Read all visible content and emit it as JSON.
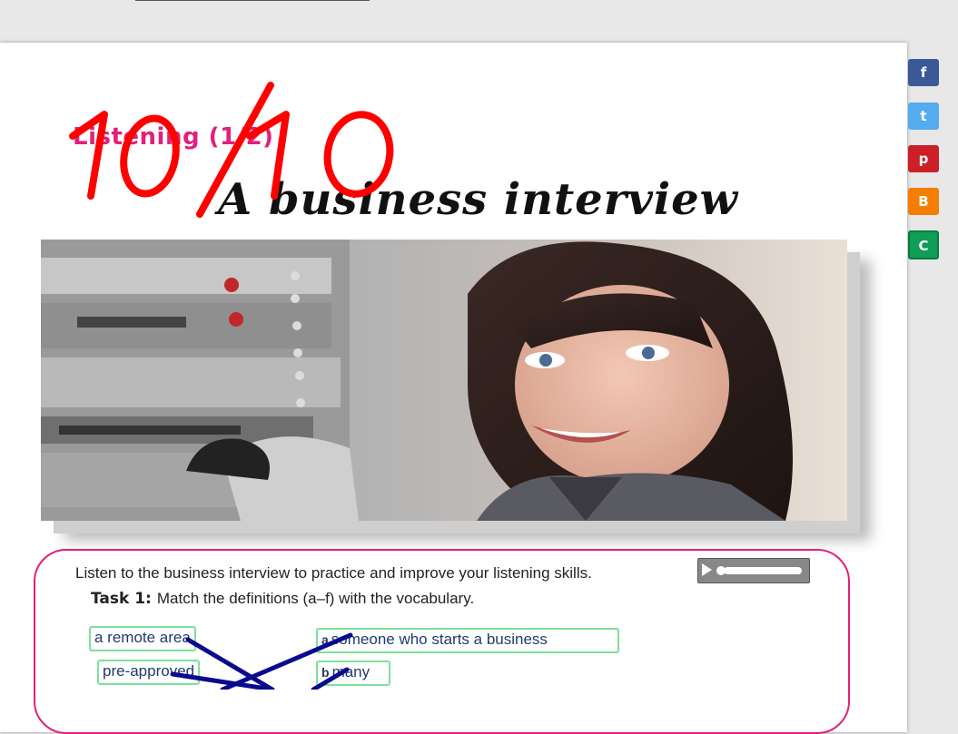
{
  "header": {
    "listening_label": "Listening (1/2)",
    "title": "A business interview",
    "score": "10/10"
  },
  "photo": {
    "description_icon": "woman-at-microphone-photo"
  },
  "exercise": {
    "intro": "Listen to the business interview to practice and improve your listening skills.",
    "task_label": "Task 1:",
    "task_text": "Match the definitions (a–f) with the vocabulary.",
    "vocab": [
      "a remote area",
      "pre-approved"
    ],
    "definitions": [
      {
        "letter": "a",
        "text": "someone who starts a business"
      },
      {
        "letter": "b",
        "text": "many"
      }
    ]
  },
  "audio_player": {
    "icon": "play-icon"
  },
  "social": [
    {
      "name": "facebook",
      "glyph": "f",
      "color": "#3b5998"
    },
    {
      "name": "twitter",
      "glyph": "t",
      "color": "#55acee"
    },
    {
      "name": "pinterest",
      "glyph": "p",
      "color": "#cb2027"
    },
    {
      "name": "blogger",
      "glyph": "B",
      "color": "#f57d00"
    },
    {
      "name": "classroom",
      "glyph": "C",
      "color": "#0f9d58"
    }
  ],
  "colors": {
    "accent_pink": "#e0217a",
    "chip_border": "#7ee09a",
    "match_line": "#0a0a8f",
    "score_red": "#ff0000"
  }
}
